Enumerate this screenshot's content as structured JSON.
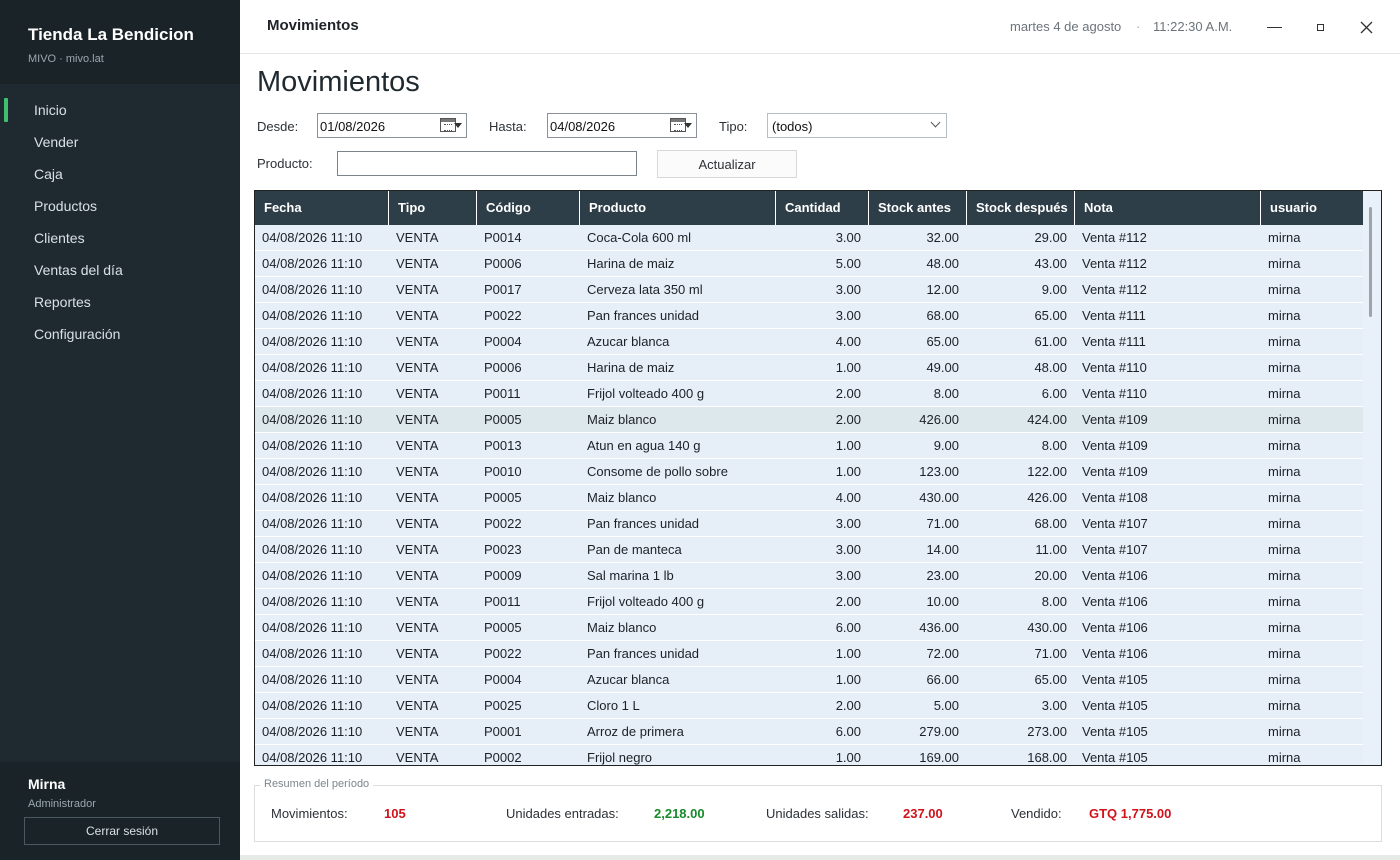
{
  "sidebar": {
    "brand_title": "Tienda La Bendicion",
    "brand_sub": "MIVO · mivo.lat",
    "items": [
      {
        "label": "Inicio",
        "active": true
      },
      {
        "label": "Vender"
      },
      {
        "label": "Caja"
      },
      {
        "label": "Productos"
      },
      {
        "label": "Clientes"
      },
      {
        "label": "Ventas del día"
      },
      {
        "label": "Reportes"
      },
      {
        "label": "Configuración"
      }
    ],
    "user_name": "Mirna",
    "user_role": "Administrador",
    "logout_label": "Cerrar sesión"
  },
  "header": {
    "title": "Movimientos",
    "date": "martes 4 de agosto",
    "separator": "·",
    "time": "11:22:30 A.M."
  },
  "filters": {
    "page_title": "Movimientos",
    "desde_label": "Desde:",
    "desde_value": "01/08/2026",
    "hasta_label": "Hasta:",
    "hasta_value": "04/08/2026",
    "tipo_label": "Tipo:",
    "tipo_value": "(todos)",
    "producto_label": "Producto:",
    "producto_value": "",
    "update_label": "Actualizar"
  },
  "table": {
    "columns": [
      "Fecha",
      "Tipo",
      "Código",
      "Producto",
      "Cantidad",
      "Stock antes",
      "Stock después",
      "Nota",
      "usuario"
    ],
    "rows": [
      [
        "04/08/2026 11:10",
        "VENTA",
        "P0014",
        "Coca-Cola 600 ml",
        "3.00",
        "32.00",
        "29.00",
        "Venta #112",
        "mirna"
      ],
      [
        "04/08/2026 11:10",
        "VENTA",
        "P0006",
        "Harina de maiz",
        "5.00",
        "48.00",
        "43.00",
        "Venta #112",
        "mirna"
      ],
      [
        "04/08/2026 11:10",
        "VENTA",
        "P0017",
        "Cerveza lata 350 ml",
        "3.00",
        "12.00",
        "9.00",
        "Venta #112",
        "mirna"
      ],
      [
        "04/08/2026 11:10",
        "VENTA",
        "P0022",
        "Pan frances unidad",
        "3.00",
        "68.00",
        "65.00",
        "Venta #111",
        "mirna"
      ],
      [
        "04/08/2026 11:10",
        "VENTA",
        "P0004",
        "Azucar blanca",
        "4.00",
        "65.00",
        "61.00",
        "Venta #111",
        "mirna"
      ],
      [
        "04/08/2026 11:10",
        "VENTA",
        "P0006",
        "Harina de maiz",
        "1.00",
        "49.00",
        "48.00",
        "Venta #110",
        "mirna"
      ],
      [
        "04/08/2026 11:10",
        "VENTA",
        "P0011",
        "Frijol volteado 400 g",
        "2.00",
        "8.00",
        "6.00",
        "Venta #110",
        "mirna"
      ],
      [
        "04/08/2026 11:10",
        "VENTA",
        "P0005",
        "Maiz blanco",
        "2.00",
        "426.00",
        "424.00",
        "Venta #109",
        "mirna"
      ],
      [
        "04/08/2026 11:10",
        "VENTA",
        "P0013",
        "Atun en agua 140 g",
        "1.00",
        "9.00",
        "8.00",
        "Venta #109",
        "mirna"
      ],
      [
        "04/08/2026 11:10",
        "VENTA",
        "P0010",
        "Consome de pollo sobre",
        "1.00",
        "123.00",
        "122.00",
        "Venta #109",
        "mirna"
      ],
      [
        "04/08/2026 11:10",
        "VENTA",
        "P0005",
        "Maiz blanco",
        "4.00",
        "430.00",
        "426.00",
        "Venta #108",
        "mirna"
      ],
      [
        "04/08/2026 11:10",
        "VENTA",
        "P0022",
        "Pan frances unidad",
        "3.00",
        "71.00",
        "68.00",
        "Venta #107",
        "mirna"
      ],
      [
        "04/08/2026 11:10",
        "VENTA",
        "P0023",
        "Pan de manteca",
        "3.00",
        "14.00",
        "11.00",
        "Venta #107",
        "mirna"
      ],
      [
        "04/08/2026 11:10",
        "VENTA",
        "P0009",
        "Sal marina 1 lb",
        "3.00",
        "23.00",
        "20.00",
        "Venta #106",
        "mirna"
      ],
      [
        "04/08/2026 11:10",
        "VENTA",
        "P0011",
        "Frijol volteado 400 g",
        "2.00",
        "10.00",
        "8.00",
        "Venta #106",
        "mirna"
      ],
      [
        "04/08/2026 11:10",
        "VENTA",
        "P0005",
        "Maiz blanco",
        "6.00",
        "436.00",
        "430.00",
        "Venta #106",
        "mirna"
      ],
      [
        "04/08/2026 11:10",
        "VENTA",
        "P0022",
        "Pan frances unidad",
        "1.00",
        "72.00",
        "71.00",
        "Venta #106",
        "mirna"
      ],
      [
        "04/08/2026 11:10",
        "VENTA",
        "P0004",
        "Azucar blanca",
        "1.00",
        "66.00",
        "65.00",
        "Venta #105",
        "mirna"
      ],
      [
        "04/08/2026 11:10",
        "VENTA",
        "P0025",
        "Cloro 1 L",
        "2.00",
        "5.00",
        "3.00",
        "Venta #105",
        "mirna"
      ],
      [
        "04/08/2026 11:10",
        "VENTA",
        "P0001",
        "Arroz de primera",
        "6.00",
        "279.00",
        "273.00",
        "Venta #105",
        "mirna"
      ],
      [
        "04/08/2026 11:10",
        "VENTA",
        "P0002",
        "Frijol negro",
        "1.00",
        "169.00",
        "168.00",
        "Venta #105",
        "mirna"
      ]
    ],
    "selected_row": 7
  },
  "summary": {
    "legend": "Resumen del período",
    "movimientos_label": "Movimientos:",
    "movimientos_value": "105",
    "entradas_label": "Unidades entradas:",
    "entradas_value": "2,218.00",
    "salidas_label": "Unidades salidas:",
    "salidas_value": "237.00",
    "vendido_label": "Vendido:",
    "vendido_value": "GTQ 1,775.00"
  },
  "colors": {
    "sidebar_bg": "#1f2a30",
    "accent_green": "#3fbf6f",
    "header_row_bg": "#2e3e48",
    "value_red": "#d0121b",
    "value_green": "#178a2c",
    "row_bg": "#e6eef8"
  },
  "icons": {
    "calendar": "calendar-icon",
    "dropdown": "chevron-down-icon",
    "minimize": "minimize-icon",
    "maximize": "maximize-icon",
    "close": "close-icon"
  }
}
